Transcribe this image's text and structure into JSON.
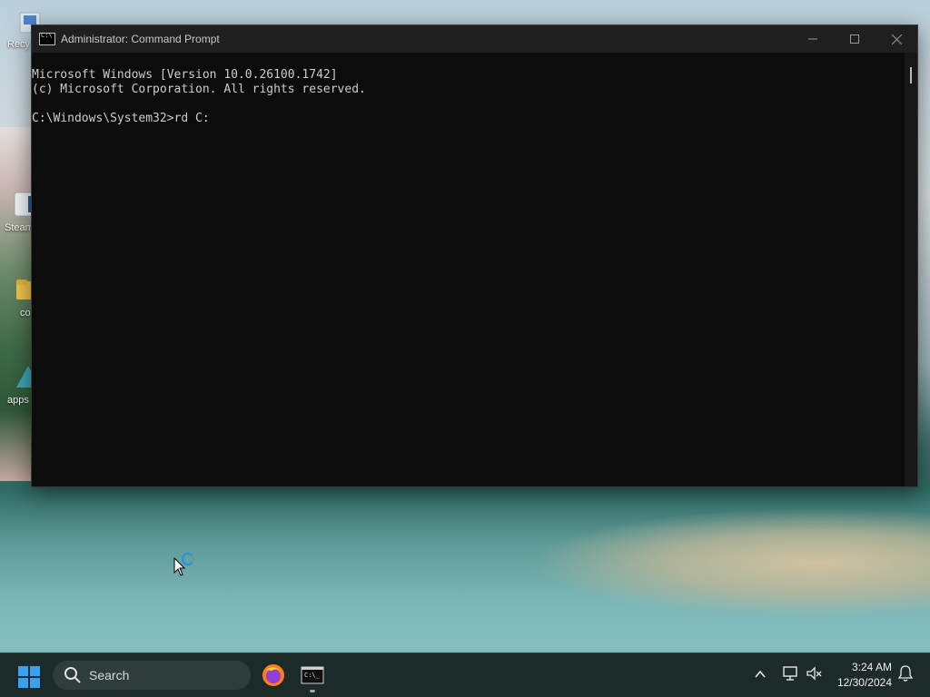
{
  "desktop": {
    "icons": [
      {
        "label": "Recy",
        "name": "recycle-bin"
      },
      {
        "label": "Steam",
        "name": "steam"
      },
      {
        "label": "co",
        "name": "folder-co"
      },
      {
        "label": "apps",
        "name": "apps"
      }
    ]
  },
  "cmd": {
    "title": "Administrator: Command Prompt",
    "lines": [
      "Microsoft Windows [Version 10.0.26100.1742]",
      "(c) Microsoft Corporation. All rights reserved.",
      "",
      "C:\\Windows\\System32>rd C:"
    ],
    "buttons": {
      "minimize": "—",
      "maximize": "☐",
      "close": "✕"
    }
  },
  "taskbar": {
    "search_placeholder": "Search",
    "apps": [
      "start-menu",
      "firefox",
      "command-prompt"
    ],
    "clock": {
      "time": "3:24 AM",
      "date": "12/30/2024"
    }
  },
  "colors": {
    "console_bg": "#0c0c0c",
    "console_text": "#cccccc",
    "taskbar_bg": "#1c2a2a",
    "accent": "#2a8be0"
  }
}
